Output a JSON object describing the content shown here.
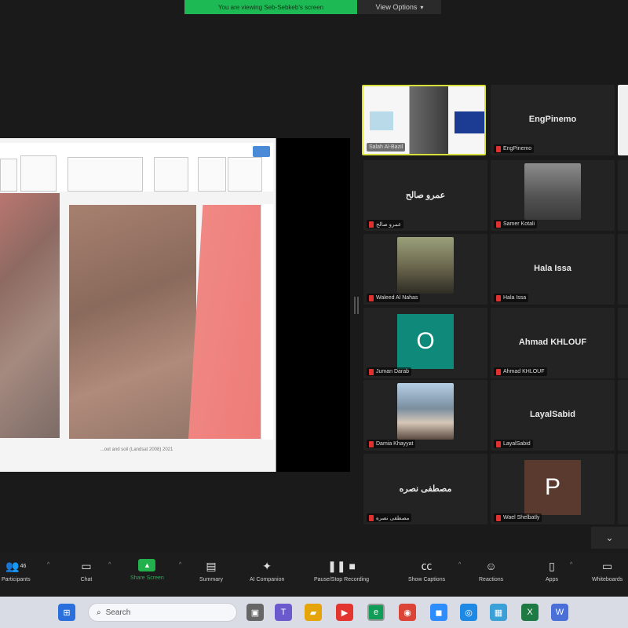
{
  "banner": {
    "sharing_text": "You are viewing Seb-Sebkeb's screen",
    "view_options_label": "View Options"
  },
  "slide": {
    "caption": "...out and soil (Landsat 2008) 2021"
  },
  "participants": [
    {
      "id": "speaker",
      "label": "Salah Al-Bazil",
      "type": "video",
      "active": true
    },
    {
      "id": "p2",
      "label": "EngPinemo",
      "center_name": "EngPinemo",
      "type": "name"
    },
    {
      "id": "p3",
      "label": "عمرو صالح",
      "center_name": "عمرو صالح",
      "type": "name"
    },
    {
      "id": "p4",
      "label": "Samer Kotali",
      "type": "photo"
    },
    {
      "id": "p5",
      "label": "Waleed Al Nahas",
      "type": "photo"
    },
    {
      "id": "p6",
      "label": "Hala Issa",
      "center_name": "Hala Issa",
      "type": "name"
    },
    {
      "id": "p7",
      "label": "Juman Darab",
      "type": "avatar",
      "initial": "O",
      "color": "#0f8a7a"
    },
    {
      "id": "p8",
      "label": "Ahmad KHLOUF",
      "center_name": "Ahmad KHLOUF",
      "type": "name"
    },
    {
      "id": "p9",
      "label": "Damia Khayyat",
      "type": "photo"
    },
    {
      "id": "p10",
      "label": "LayalSabid",
      "center_name": "LayalSabid",
      "type": "name"
    },
    {
      "id": "p11",
      "label": "مصطفى نصره",
      "center_name": "مصطفى نصره",
      "type": "name"
    },
    {
      "id": "p12",
      "label": "Wael Shelbatly",
      "type": "avatar",
      "initial": "P",
      "color": "#5a3a2e"
    }
  ],
  "toolbar": {
    "participants": "Participants",
    "participants_count": "46",
    "chat": "Chat",
    "share_screen": "Share Screen",
    "summary": "Summary",
    "ai_companion": "AI Companion",
    "recording": "Pause/Stop Recording",
    "captions": "Show Captions",
    "reactions": "Reactions",
    "apps": "Apps",
    "whiteboards": "Whiteboards"
  },
  "taskbar": {
    "search_placeholder": "Search"
  },
  "colors": {
    "accent_green": "#23b14d",
    "active_border": "#d8e03a",
    "muted_red": "#e03131"
  }
}
